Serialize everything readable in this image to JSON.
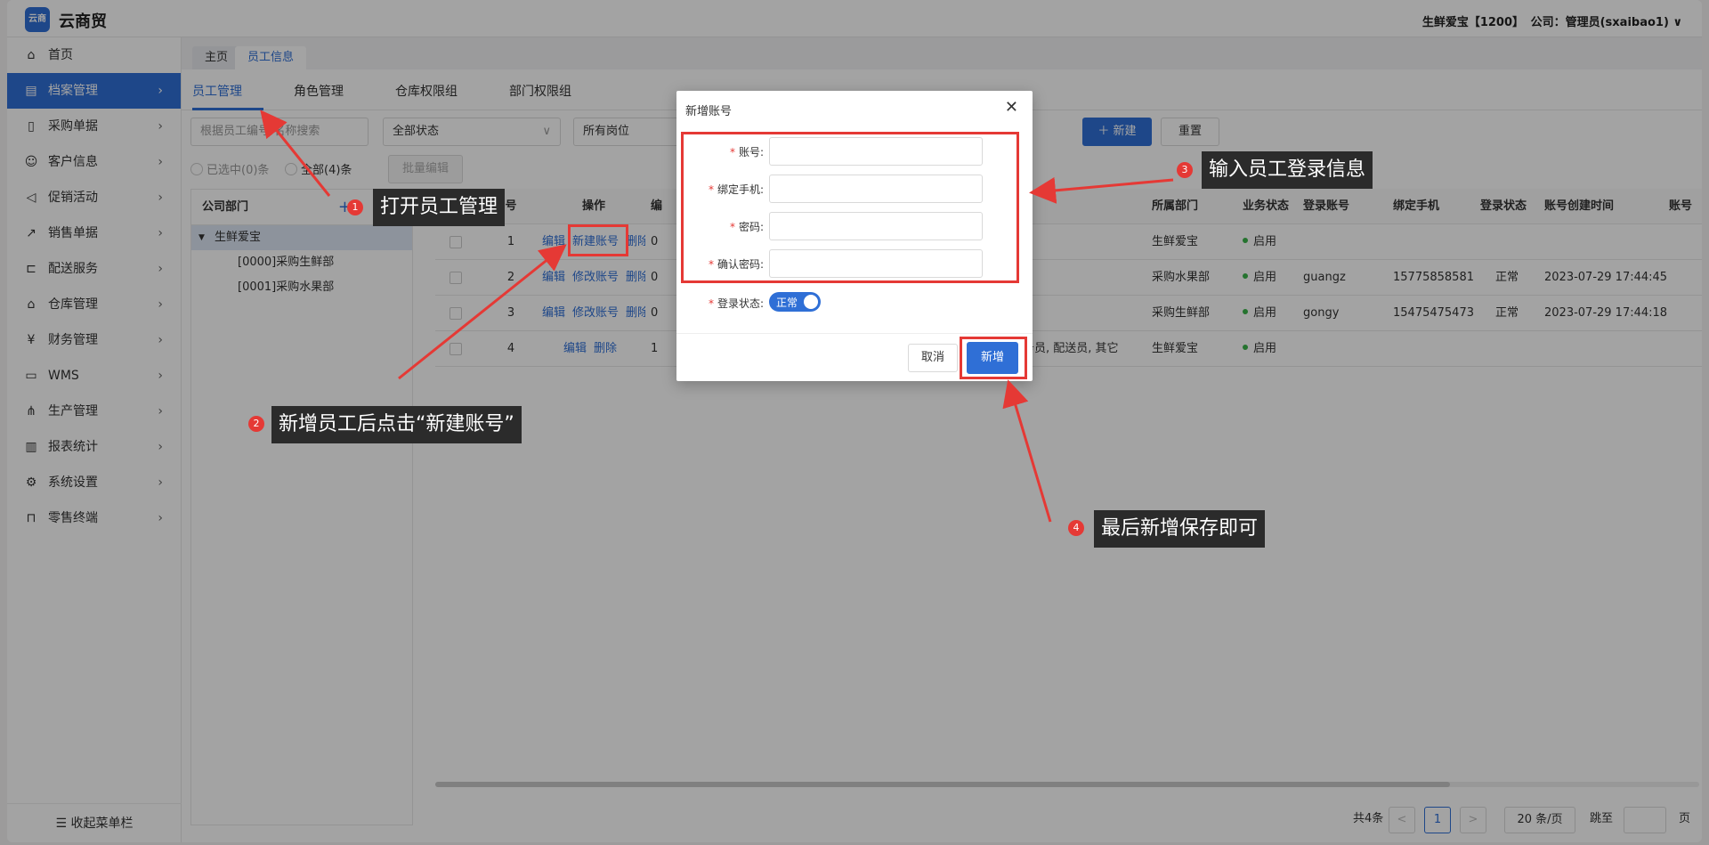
{
  "app": {
    "logo_text": "云商",
    "title": "云商贸",
    "tenant": "生鲜爱宝【1200】",
    "company": "公司：管理员(sxaibao1)"
  },
  "sidebar": {
    "items": [
      {
        "label": "首页",
        "icon": "home-icon",
        "glyph": "⌂"
      },
      {
        "label": "档案管理",
        "icon": "archive-icon",
        "glyph": "▤"
      },
      {
        "label": "采购单据",
        "icon": "document-icon",
        "glyph": "▯"
      },
      {
        "label": "客户信息",
        "icon": "user-icon",
        "glyph": "☺"
      },
      {
        "label": "促销活动",
        "icon": "megaphone-icon",
        "glyph": "◁"
      },
      {
        "label": "销售单据",
        "icon": "chart-icon",
        "glyph": "↗"
      },
      {
        "label": "配送服务",
        "icon": "cart-icon",
        "glyph": "⊏"
      },
      {
        "label": "仓库管理",
        "icon": "warehouse-icon",
        "glyph": "⌂"
      },
      {
        "label": "财务管理",
        "icon": "finance-icon",
        "glyph": "¥"
      },
      {
        "label": "WMS",
        "icon": "truck-icon",
        "glyph": "▭"
      },
      {
        "label": "生产管理",
        "icon": "network-icon",
        "glyph": "⋔"
      },
      {
        "label": "报表统计",
        "icon": "report-icon",
        "glyph": "▥"
      },
      {
        "label": "系统设置",
        "icon": "gear-icon",
        "glyph": "⚙"
      },
      {
        "label": "零售终端",
        "icon": "bag-icon",
        "glyph": "⊓"
      }
    ],
    "collapse_label": "☰ 收起菜单栏"
  },
  "page_tabs": [
    "主页",
    "员工信息"
  ],
  "sub_tabs": [
    "员工管理",
    "角色管理",
    "仓库权限组",
    "部门权限组"
  ],
  "filters": {
    "search_placeholder": "根据员工编号/名称搜索",
    "status": "全部状态",
    "position": "所有岗位",
    "reset": "重置",
    "add": "＋ 新建",
    "selected": "已选中(0)条",
    "all": "全部(4)条",
    "batch_edit": "批量编辑"
  },
  "dept": {
    "header": "公司部门",
    "add": "+",
    "root": "生鲜爱宝",
    "children": [
      "[0000]采购生鲜部",
      "[0001]采购水果部"
    ]
  },
  "table": {
    "headers": {
      "no": "号",
      "ops": "操作",
      "col3": "编",
      "dept": "所属部门",
      "status": "业务状态",
      "login": "登录账号",
      "phone": "绑定手机",
      "login_status": "登录状态",
      "created": "账号创建时间",
      "last": "账号"
    },
    "rows": [
      {
        "no": "1",
        "ops": [
          "编辑",
          "新建账号",
          "删除"
        ],
        "col3": "0",
        "role": "",
        "dept": "生鲜爱宝",
        "status": "启用",
        "login": "",
        "phone": "",
        "login_status": "",
        "created": ""
      },
      {
        "no": "2",
        "ops": [
          "编辑",
          "修改账号",
          "删除"
        ],
        "col3": "0",
        "role": "",
        "dept": "采购水果部",
        "status": "启用",
        "login": "guangz",
        "phone": "15775858581",
        "login_status": "正常",
        "created": "2023-07-29 17:44:45"
      },
      {
        "no": "3",
        "ops": [
          "编辑",
          "修改账号",
          "删除"
        ],
        "col3": "0",
        "role": "",
        "dept": "采购生鲜部",
        "status": "启用",
        "login": "gongy",
        "phone": "15475475473",
        "login_status": "正常",
        "created": "2023-07-29 17:44:18"
      },
      {
        "no": "4",
        "ops": [
          "编辑",
          "删除"
        ],
        "col3": "1",
        "role": "务员, 配送员, 其它",
        "dept": "生鲜爱宝",
        "status": "启用",
        "login": "",
        "phone": "",
        "login_status": "",
        "created": ""
      }
    ]
  },
  "pager": {
    "total": "共4条",
    "prev": "<",
    "page": "1",
    "next": ">",
    "size": "20 条/页",
    "jump": "跳至",
    "unit": "页"
  },
  "dialog": {
    "title": "新增账号",
    "close": "✕",
    "fields": [
      {
        "label": "账号:"
      },
      {
        "label": "绑定手机:"
      },
      {
        "label": "密码:"
      },
      {
        "label": "确认密码:"
      }
    ],
    "login_status_label": "登录状态:",
    "toggle_text": "正常",
    "cancel": "取消",
    "submit": "新增"
  },
  "annotations": {
    "step1": {
      "badge": "1",
      "text": "打开员工管理"
    },
    "step2": {
      "badge": "2",
      "text": "新增员工后点击“新建账号”"
    },
    "step3": {
      "badge": "3",
      "text": "输入员工登录信息"
    },
    "step4": {
      "badge": "4",
      "text": "最后新增保存即可"
    }
  },
  "colors": {
    "primary": "#2f6fd6",
    "annotation_red": "#e53935",
    "callout_bg": "#2b2b2b"
  }
}
